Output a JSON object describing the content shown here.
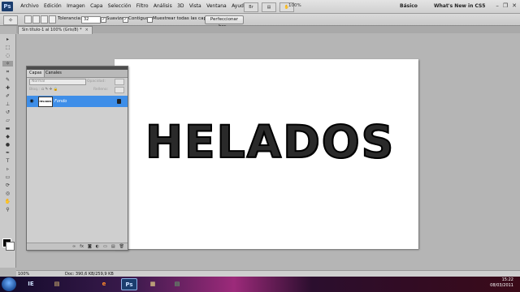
{
  "app": {
    "logo": "Ps"
  },
  "menubar": {
    "items": [
      "Archivo",
      "Edición",
      "Imagen",
      "Capa",
      "Selección",
      "Filtro",
      "Análisis",
      "3D",
      "Vista",
      "Ventana",
      "Ayuda"
    ],
    "zoom": "100%",
    "workspace_basic": "Básico",
    "workspace_new": "What's New in CS5",
    "win_minimize": "–",
    "win_restore": "❐",
    "win_close": "✕"
  },
  "options": {
    "tolerance_label": "Tolerancia:",
    "tolerance_value": "32",
    "smooth_label": "Suavizar",
    "contiguous_label": "Contiguo",
    "sample_all_label": "Muestrear todas las capas",
    "refine_button": "Perfeccionar bor..."
  },
  "document": {
    "tab_title": "Sin título-1 al 100% (Gris/8) *",
    "tab_close": "×",
    "canvas_text": "HELADOS"
  },
  "layers_panel": {
    "tabs": [
      "Capas",
      "Canales"
    ],
    "blend_mode": "Normal",
    "opacity_label": "Opacidad:",
    "lock_label": "Bloq.:",
    "fill_label": "Relleno:",
    "layer_name": "Fondo",
    "thumb_text": "HELADOS",
    "footer_icons": [
      "∞",
      "fx",
      "◙",
      "◐",
      "▭",
      "▤",
      "🗑"
    ]
  },
  "status": {
    "zoom": "100%",
    "doc_info": "Doc: 390,6 KB/259,9 KB"
  },
  "taskbar": {
    "apps": [
      "IE",
      "▤",
      "e",
      "Ps",
      "▦",
      "▤"
    ],
    "time": "15:22",
    "date": "08/03/2011"
  }
}
